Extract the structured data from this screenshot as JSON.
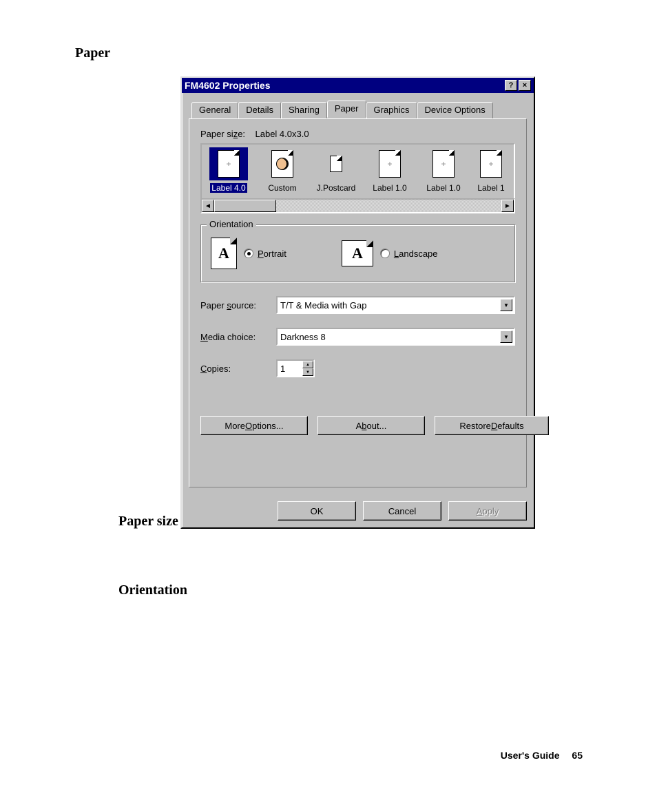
{
  "headings": {
    "paper": "Paper",
    "paper_size": "Paper size",
    "orientation": "Orientation"
  },
  "footer": {
    "label": "User's Guide",
    "page": "65"
  },
  "dialog": {
    "title": "FM4602 Properties",
    "title_buttons": {
      "help": "?",
      "close": "×"
    },
    "tabs": {
      "general": "General",
      "details": "Details",
      "sharing": "Sharing",
      "paper": "Paper",
      "graphics": "Graphics",
      "device_options": "Device Options"
    },
    "paper_size": {
      "label_prefix": "Paper si",
      "label_key": "z",
      "label_suffix": "e:",
      "value": "Label 4.0x3.0",
      "items": [
        {
          "label": "Label 4.0",
          "type": "page",
          "selected": true
        },
        {
          "label": "Custom",
          "type": "custom"
        },
        {
          "label": "J.Postcard",
          "type": "small"
        },
        {
          "label": "Label 1.0",
          "type": "page"
        },
        {
          "label": "Label 1.0",
          "type": "page"
        },
        {
          "label": "Label 1",
          "type": "page"
        }
      ]
    },
    "orientation": {
      "legend": "Orientation",
      "portrait_key": "P",
      "portrait_rest": "ortrait",
      "landscape_key": "L",
      "landscape_rest": "andscape",
      "selected": "portrait",
      "glyph": "A"
    },
    "paper_source": {
      "label_prefix": "Paper ",
      "label_key": "s",
      "label_suffix": "ource:",
      "value": "T/T & Media with Gap"
    },
    "media_choice": {
      "label_key": "M",
      "label_rest": "edia choice:",
      "value": "Darkness 8"
    },
    "copies": {
      "label_key": "C",
      "label_rest": "opies:",
      "value": "1"
    },
    "buttons": {
      "more_options_pre": "More ",
      "more_options_key": "O",
      "more_options_post": "ptions...",
      "about_pre": "A",
      "about_key": "b",
      "about_post": "out...",
      "restore_pre": "Restore ",
      "restore_key": "D",
      "restore_post": "efaults",
      "ok": "OK",
      "cancel": "Cancel",
      "apply_key": "A",
      "apply_rest": "pply"
    }
  }
}
